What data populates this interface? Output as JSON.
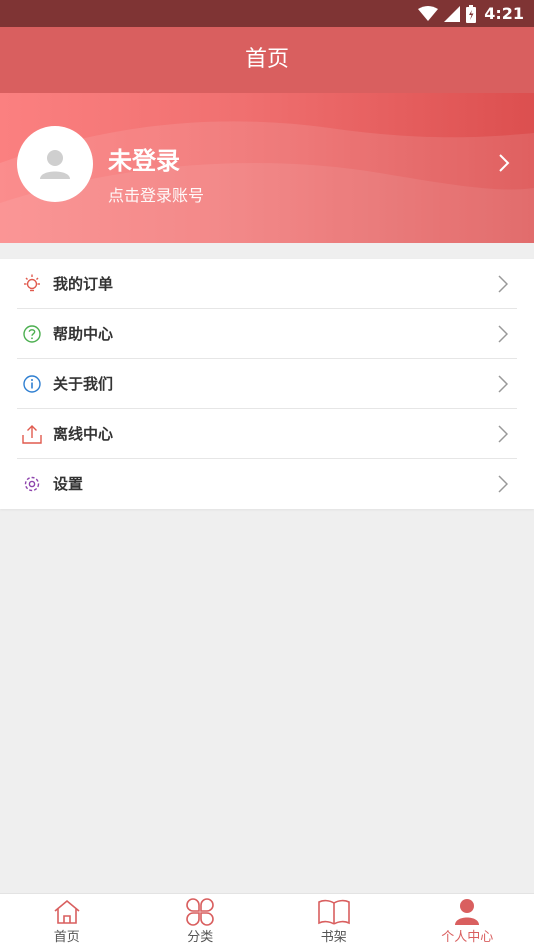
{
  "status_bar": {
    "time": "4:21",
    "icons": [
      "wifi-icon",
      "cell-signal-icon",
      "battery-icon"
    ]
  },
  "app_bar": {
    "title": "首页"
  },
  "profile": {
    "title": "未登录",
    "subtitle": "点击登录账号",
    "avatar_icon": "person-icon"
  },
  "menu": {
    "items": [
      {
        "label": "我的订单",
        "icon": "lightbulb-icon",
        "icon_color": "#e05a4e"
      },
      {
        "label": "帮助中心",
        "icon": "question-circle-icon",
        "icon_color": "#4caf50"
      },
      {
        "label": "关于我们",
        "icon": "info-circle-icon",
        "icon_color": "#2f7fd1"
      },
      {
        "label": "离线中心",
        "icon": "upload-icon",
        "icon_color": "#e05a4e"
      },
      {
        "label": "设置",
        "icon": "settings-gear-icon",
        "icon_color": "#8e44ad"
      }
    ]
  },
  "tab_bar": {
    "tabs": [
      {
        "label": "首页",
        "icon": "home-icon"
      },
      {
        "label": "分类",
        "icon": "category-clover-icon"
      },
      {
        "label": "书架",
        "icon": "open-book-icon"
      },
      {
        "label": "个人中心",
        "icon": "user-icon",
        "active": true
      }
    ]
  },
  "colors": {
    "accent": "#d95f5f",
    "status_bar": "#7f3434",
    "background": "#efefef"
  }
}
